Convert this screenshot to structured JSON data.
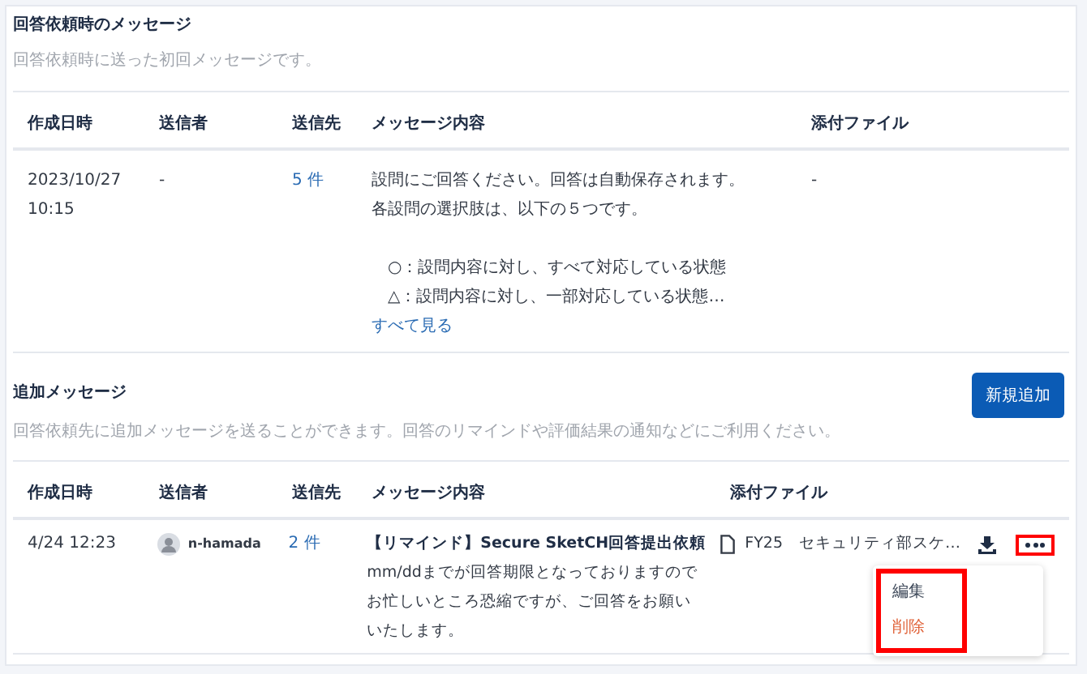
{
  "initial_section": {
    "title": "回答依頼時のメッセージ",
    "description": "回答依頼時に送った初回メッセージです。",
    "columns": [
      "作成日時",
      "送信者",
      "送信先",
      "メッセージ内容",
      "添付ファイル"
    ],
    "rows": [
      {
        "created": [
          "2023/10/27",
          "10:15"
        ],
        "sender": "-",
        "recipients": "5 件",
        "message_lines": [
          "設問にご回答ください。回答は自動保存されます。",
          "各設問の選択肢は、以下の５つです。"
        ],
        "option_lines": [
          "　○：設問内容に対し、すべて対応している状態",
          "　△：設問内容に対し、一部対応している状態…"
        ],
        "see_all": "すべて見る",
        "attachment": "-"
      }
    ]
  },
  "additional_section": {
    "title": "追加メッセージ",
    "description": "回答依頼先に追加メッセージを送ることができます。回答のリマインドや評価結果の通知などにご利用ください。",
    "new_button": "新規追加",
    "columns": [
      "作成日時",
      "送信者",
      "送信先",
      "メッセージ内容",
      "添付ファイル"
    ],
    "rows": [
      {
        "created": "4/24 12:23",
        "sender": "n-hamada",
        "recipients": "2 件",
        "message_title": "【リマインド】Secure SketCH回答提出依頼",
        "message_lines": [
          "mm/ddまでが回答期限となっておりますので",
          "お忙しいところ恐縮ですが、ご回答をお願い",
          "いたします。"
        ],
        "attachment": "FY25　セキュリティ部スケ…",
        "menu_open": true,
        "menu": [
          {
            "label": "編集",
            "kind": "normal"
          },
          {
            "label": "削除",
            "kind": "danger"
          }
        ]
      }
    ]
  }
}
